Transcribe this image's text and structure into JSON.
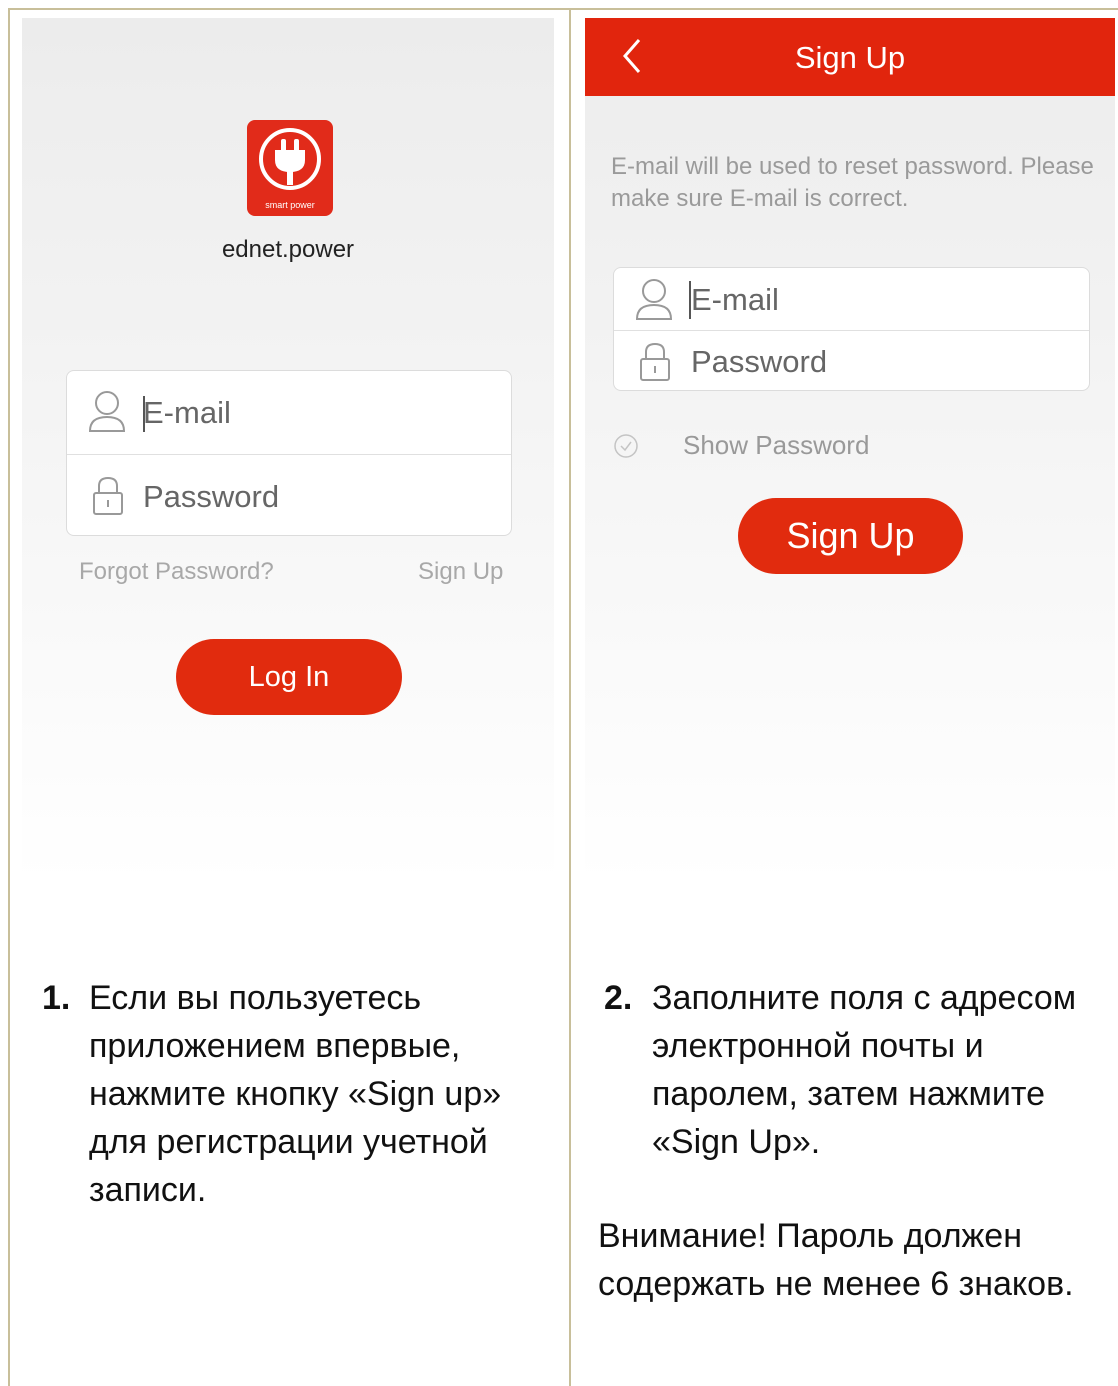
{
  "login": {
    "logo_caption": "smart power",
    "app_name": "ednet.power",
    "email_placeholder": "E-mail",
    "password_placeholder": "Password",
    "forgot_password": "Forgot Password?",
    "sign_up_link": "Sign Up",
    "login_button": "Log In"
  },
  "signup": {
    "title": "Sign Up",
    "notice": "E-mail will be used to reset password. Please make sure E-mail is correct.",
    "email_placeholder": "E-mail",
    "password_placeholder": "Password",
    "show_password": "Show Password",
    "signup_button": "Sign Up"
  },
  "instructions": {
    "step1_number": "1.",
    "step1_text": "Если вы пользуетесь приложением впервые, нажмите кнопку «Sign up» для регистрации учетной записи.",
    "step2_number": "2.",
    "step2_text": "Заполните поля с адресом электронной почты и паролем, затем нажмите «Sign Up».",
    "warning": "Внимание! Пароль должен содержать не менее 6 знаков."
  },
  "colors": {
    "accent": "#e12b0e",
    "frame": "#c8bf9a"
  },
  "icons": {
    "logo": "plug-icon",
    "email": "user-icon",
    "password": "lock-icon",
    "back": "chevron-left-icon",
    "checkbox": "check-circle-icon"
  }
}
